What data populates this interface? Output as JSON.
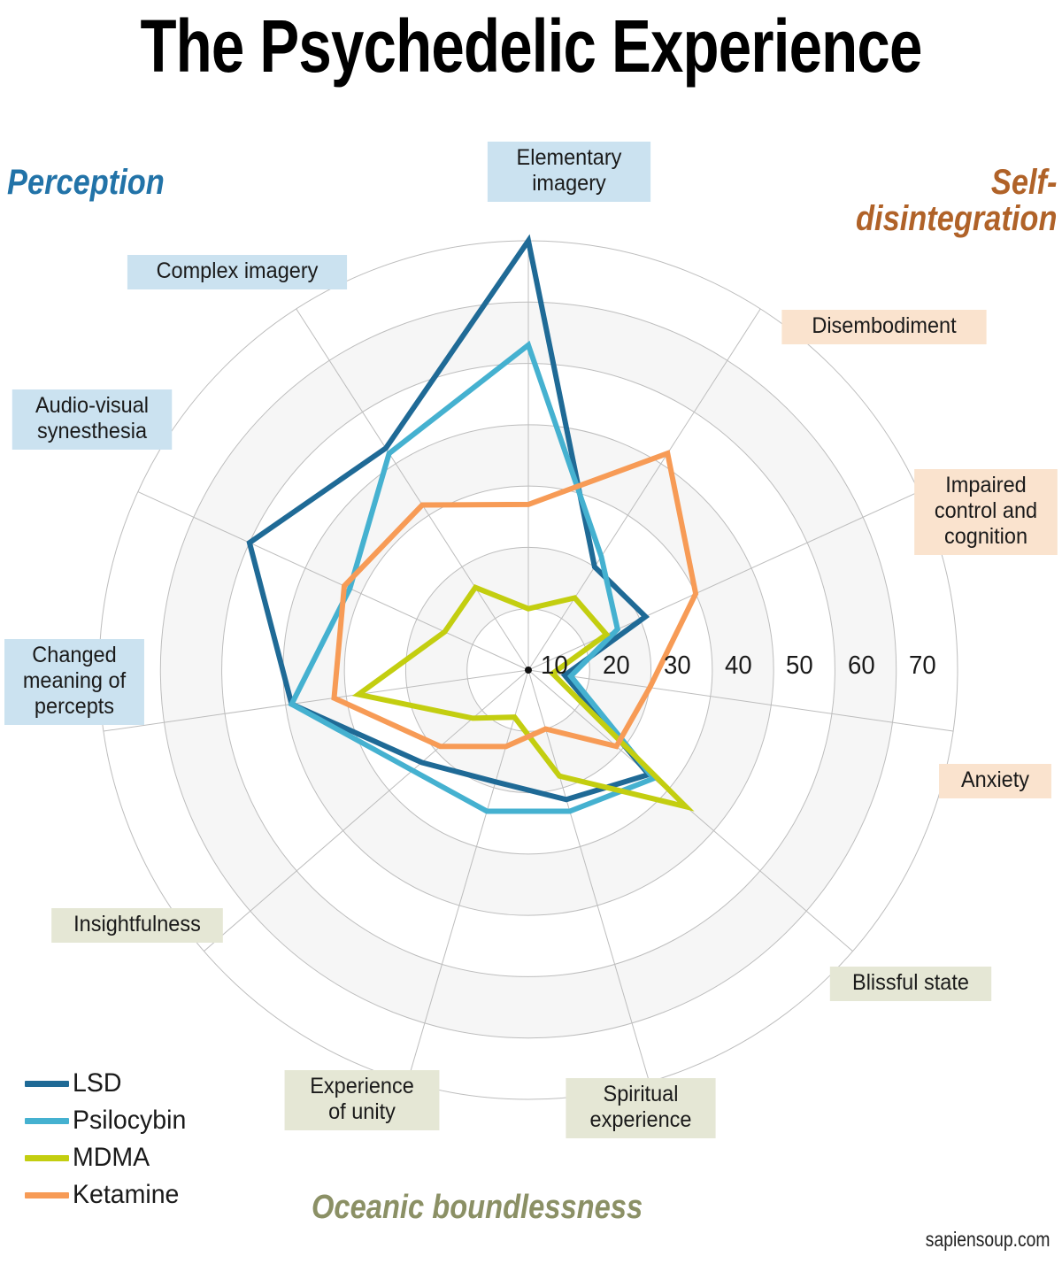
{
  "title": "The Psychedelic Experience",
  "watermark": "sapiensoup.com",
  "groups": [
    {
      "id": "perception",
      "label": "Perception",
      "color": "#2273A8"
    },
    {
      "id": "self",
      "label": "Self-\ndisintegration",
      "color": "#B06228"
    },
    {
      "id": "oceanic",
      "label": "Oceanic boundlessness",
      "color": "#8B9065"
    }
  ],
  "legend": {
    "items": [
      {
        "label": "LSD",
        "color": "#1F6A96"
      },
      {
        "label": "Psilocybin",
        "color": "#45B1D0"
      },
      {
        "label": "MDMA",
        "color": "#C3CE10"
      },
      {
        "label": "Ketamine",
        "color": "#F79B56"
      }
    ]
  },
  "chart_data": {
    "type": "radar",
    "title": "The Psychedelic Experience",
    "rmin": 0,
    "rmax": 70,
    "tick_labels": [
      "10",
      "20",
      "30",
      "40",
      "50",
      "60",
      "70"
    ],
    "tick_values": [
      10,
      20,
      30,
      40,
      50,
      60,
      70
    ],
    "grid": true,
    "legend_position": "bottom-left",
    "categories": [
      "Elementary imagery",
      "Disembodiment",
      "Impaired control and cognition",
      "Anxiety",
      "Blissful state",
      "Spiritual experience",
      "Experience of unity",
      "Insightfulness",
      "Changed meaning of percepts",
      "Audio-visual synesthesia",
      "Complex imagery"
    ],
    "category_groups": [
      "self",
      "self",
      "self",
      "self",
      "oceanic",
      "oceanic",
      "oceanic",
      "oceanic",
      "perception",
      "perception",
      "perception"
    ],
    "series": [
      {
        "name": "LSD",
        "color": "#1F6A96",
        "values": [
          70,
          20,
          21,
          6,
          26,
          22,
          19,
          23,
          39,
          50,
          43
        ]
      },
      {
        "name": "Psilocybin",
        "color": "#45B1D0",
        "values": [
          53,
          22,
          16,
          7,
          27,
          24,
          24,
          25,
          39,
          32,
          42
        ]
      },
      {
        "name": "MDMA",
        "color": "#C3CE10",
        "values": [
          10,
          14,
          14,
          4,
          34,
          18,
          8,
          12,
          28,
          15,
          16
        ]
      },
      {
        "name": "Ketamine",
        "color": "#F79B56",
        "values": [
          27,
          42,
          30,
          20,
          19,
          10,
          13,
          19,
          32,
          33,
          32
        ]
      }
    ],
    "axis_labels": [
      {
        "key": "elementary-imagery",
        "text": "Elementary\nimagery",
        "group": "perception",
        "box": "blue"
      },
      {
        "key": "disembodiment",
        "text": "Disembodiment",
        "group": "self",
        "box": "peach"
      },
      {
        "key": "impaired-control",
        "text": "Impaired\ncontrol and\ncognition",
        "group": "self",
        "box": "peach"
      },
      {
        "key": "anxiety",
        "text": "Anxiety",
        "group": "self",
        "box": "peach"
      },
      {
        "key": "blissful-state",
        "text": "Blissful state",
        "group": "oceanic",
        "box": "olive"
      },
      {
        "key": "spiritual-experience",
        "text": "Spiritual\nexperience",
        "group": "oceanic",
        "box": "olive"
      },
      {
        "key": "experience-of-unity",
        "text": "Experience\nof unity",
        "group": "oceanic",
        "box": "olive"
      },
      {
        "key": "insightfulness",
        "text": "Insightfulness",
        "group": "oceanic",
        "box": "olive"
      },
      {
        "key": "changed-meaning",
        "text": "Changed\nmeaning of\npercepts",
        "group": "perception",
        "box": "blue"
      },
      {
        "key": "audio-visual",
        "text": "Audio-visual\nsynesthesia",
        "group": "perception",
        "box": "blue"
      },
      {
        "key": "complex-imagery",
        "text": "Complex imagery",
        "group": "perception",
        "box": "blue"
      }
    ]
  }
}
